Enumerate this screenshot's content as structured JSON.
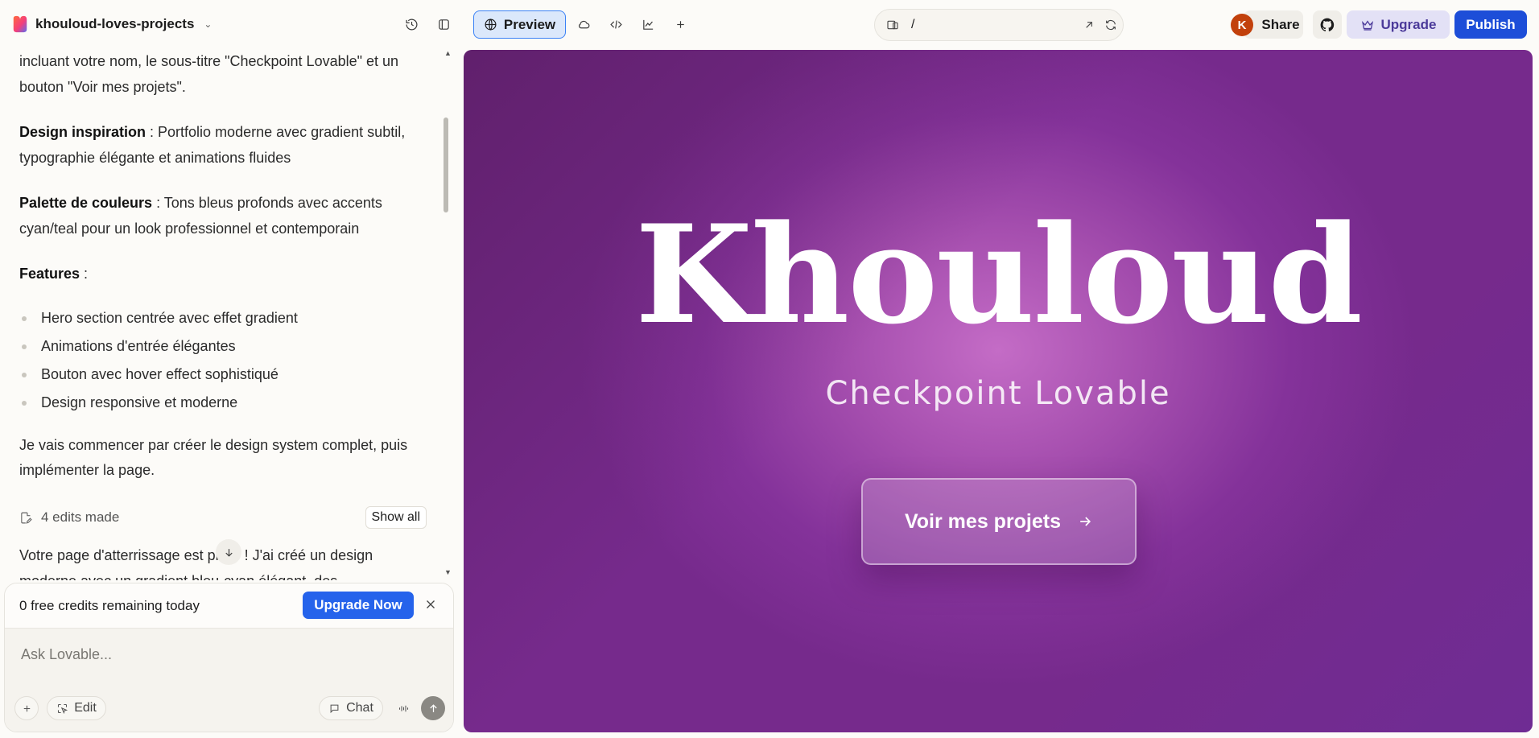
{
  "project": {
    "name": "khouloud-loves-projects"
  },
  "toolbar": {
    "preview_label": "Preview",
    "url_path": "/",
    "avatar_initial": "K",
    "share_label": "Share",
    "upgrade_label": "Upgrade",
    "publish_label": "Publish"
  },
  "chat": {
    "intro_text": "incluant votre nom, le sous-titre \"Checkpoint Lovable\" et un bouton \"Voir mes projets\".",
    "design_label": "Design inspiration",
    "design_text": " : Portfolio moderne avec gradient subtil, typographie élégante et animations fluides",
    "palette_label": "Palette de couleurs",
    "palette_text": " : Tons bleus profonds avec accents cyan/teal pour un look professionnel et contemporain",
    "features_label": "Features",
    "features_suffix": " :",
    "features": [
      "Hero section centrée avec effet gradient",
      "Animations d'entrée élégantes",
      "Bouton avec hover effect sophistiqué",
      "Design responsive et moderne"
    ],
    "plan_text": "Je vais commencer par créer le design system complet, puis implémenter la page.",
    "edits_label": "4 edits made",
    "show_all_label": "Show all",
    "tail_text": "Votre page d'atterrissage est prête ! J'ai créé un design moderne avec un gradient bleu-cyan élégant, des"
  },
  "composer": {
    "credits_text": "0 free credits remaining today",
    "upgrade_now_label": "Upgrade Now",
    "placeholder": "Ask Lovable...",
    "edit_label": "Edit",
    "chat_label": "Chat"
  },
  "preview": {
    "hero_name": "Khouloud",
    "hero_subtitle": "Checkpoint Lovable",
    "cta_label": "Voir mes projets"
  },
  "colors": {
    "accent_blue": "#1d4ed8",
    "preview_gradient_center": "#c46cc6",
    "preview_gradient_edge": "#762a8c"
  }
}
